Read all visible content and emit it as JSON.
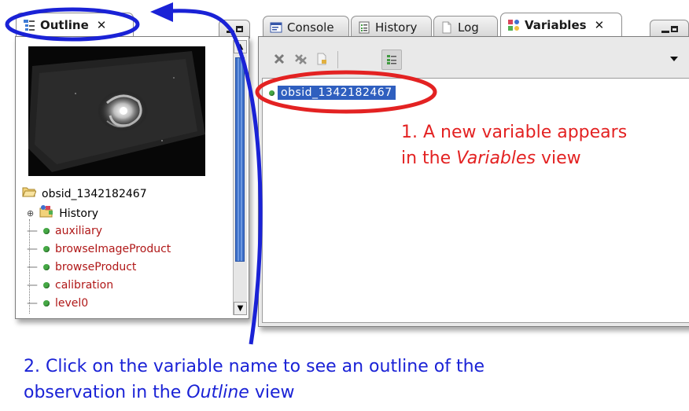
{
  "outline_tab": {
    "label": "Outline",
    "close": "✕"
  },
  "right_tabs": [
    {
      "label": "Console"
    },
    {
      "label": "History"
    },
    {
      "label": "Log"
    },
    {
      "label": "Variables",
      "close": "✕"
    }
  ],
  "variables": {
    "items": [
      "obsid_1342182467"
    ]
  },
  "outline": {
    "root": "obsid_1342182467",
    "history": "History",
    "children": [
      "auxiliary",
      "browseImageProduct",
      "browseProduct",
      "calibration",
      "level0"
    ]
  },
  "annotations": {
    "step1_line1": "1. A new variable appears",
    "step1_line2_prefix": "in the ",
    "step1_line2_em": "Variables",
    "step1_line2_suffix": " view",
    "step2_line1": "2. Click on the variable name to see an outline of the",
    "step2_line2_prefix": "observation in the ",
    "step2_line2_em": "Outline",
    "step2_line2_suffix": " view"
  },
  "colors": {
    "annotation_red": "#e32222",
    "annotation_blue": "#1a22d6",
    "selection": "#2f5fbf",
    "child_text": "#b01818"
  }
}
